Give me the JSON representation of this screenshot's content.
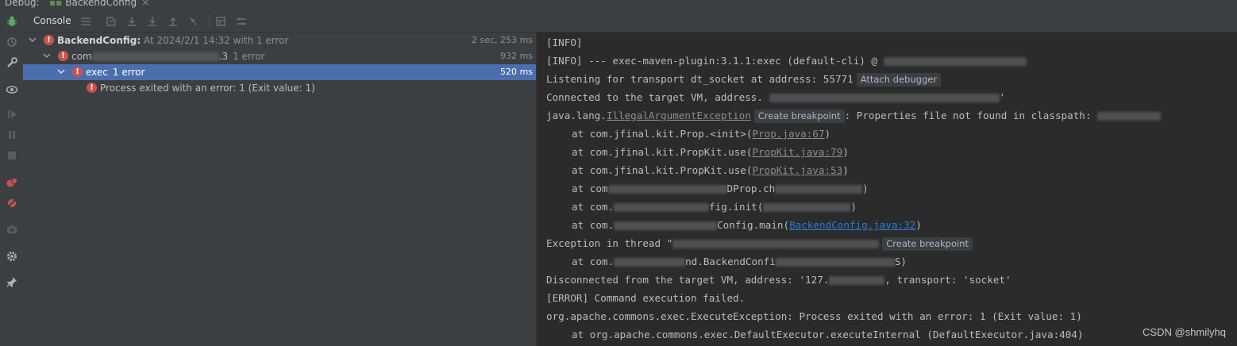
{
  "window": {
    "debug_label": "Debug:",
    "run_tab_label": "BackendConfig",
    "run_tab_close": "×"
  },
  "toolbar": {
    "console_tab": "Console"
  },
  "tree": {
    "rows": [
      {
        "title": "BackendConfig:",
        "detail": "At 2024/2/1 14:32 with 1 error",
        "time": "2 sec, 253 ms"
      },
      {
        "prefix": "com",
        "suffix": ".3",
        "count": "1 error",
        "time": "932 ms"
      },
      {
        "title": "exec",
        "count": "1 error",
        "time": "520 ms"
      },
      {
        "title": "Process exited with an error: 1 (Exit value: 1)"
      }
    ]
  },
  "console": {
    "l1": "[INFO]",
    "l2": "[INFO] --- exec-maven-plugin:3.1.1:exec (default-cli) @ ",
    "l3": "Listening for transport dt_socket at address: 55771",
    "l3_hint": "Attach debugger",
    "l4a": "Connected to the target VM, address. ",
    "l4b": "'",
    "l5a": "java.lang.",
    "l5_link": "IllegalArgumentException",
    "l5_hint": "Create breakpoint",
    "l5b": ": Properties file not found in classpath: ",
    "l6a": "at com.jfinal.kit.Prop.<init>(",
    "l6_link": "Prop.java:67",
    "l6b": ")",
    "l7a": "at com.jfinal.kit.PropKit.use(",
    "l7_link": "PropKit.java:79",
    "l7b": ")",
    "l8a": "at com.jfinal.kit.PropKit.use(",
    "l8_link": "PropKit.java:53",
    "l8b": ")",
    "l9a": "at com",
    "l9b": "DProp.ch",
    "l9c": ")",
    "l10a": "at com.",
    "l10b": "fig.init(",
    "l10c": ")",
    "l11a": "at com.",
    "l11b": "Config.main(",
    "l11_link": "BackendConfig.java:32",
    "l11c": ")",
    "l12a": "Exception in thread \"",
    "l12_hint": "Create breakpoint",
    "l13a": "at com.",
    "l13b": "nd.BackendConfi",
    "l13c": "S)",
    "l14a": "Disconnected from the target VM, address: '127.",
    "l14b": ", transport: 'socket'",
    "l15": "[ERROR] Command execution failed.",
    "l16": "org.apache.commons.exec.ExecuteException: Process exited with an error: 1 (Exit value: 1)",
    "l17": "at org.apache.commons.exec.DefaultExecutor.executeInternal (DefaultExecutor.java:404)"
  },
  "watermark": "CSDN @shmilyhq",
  "colors": {
    "error": "#c75450",
    "selection": "#4b6eaf",
    "link": "#287bde",
    "panel": "#3c3f41",
    "console_bg": "#2b2b2b"
  }
}
